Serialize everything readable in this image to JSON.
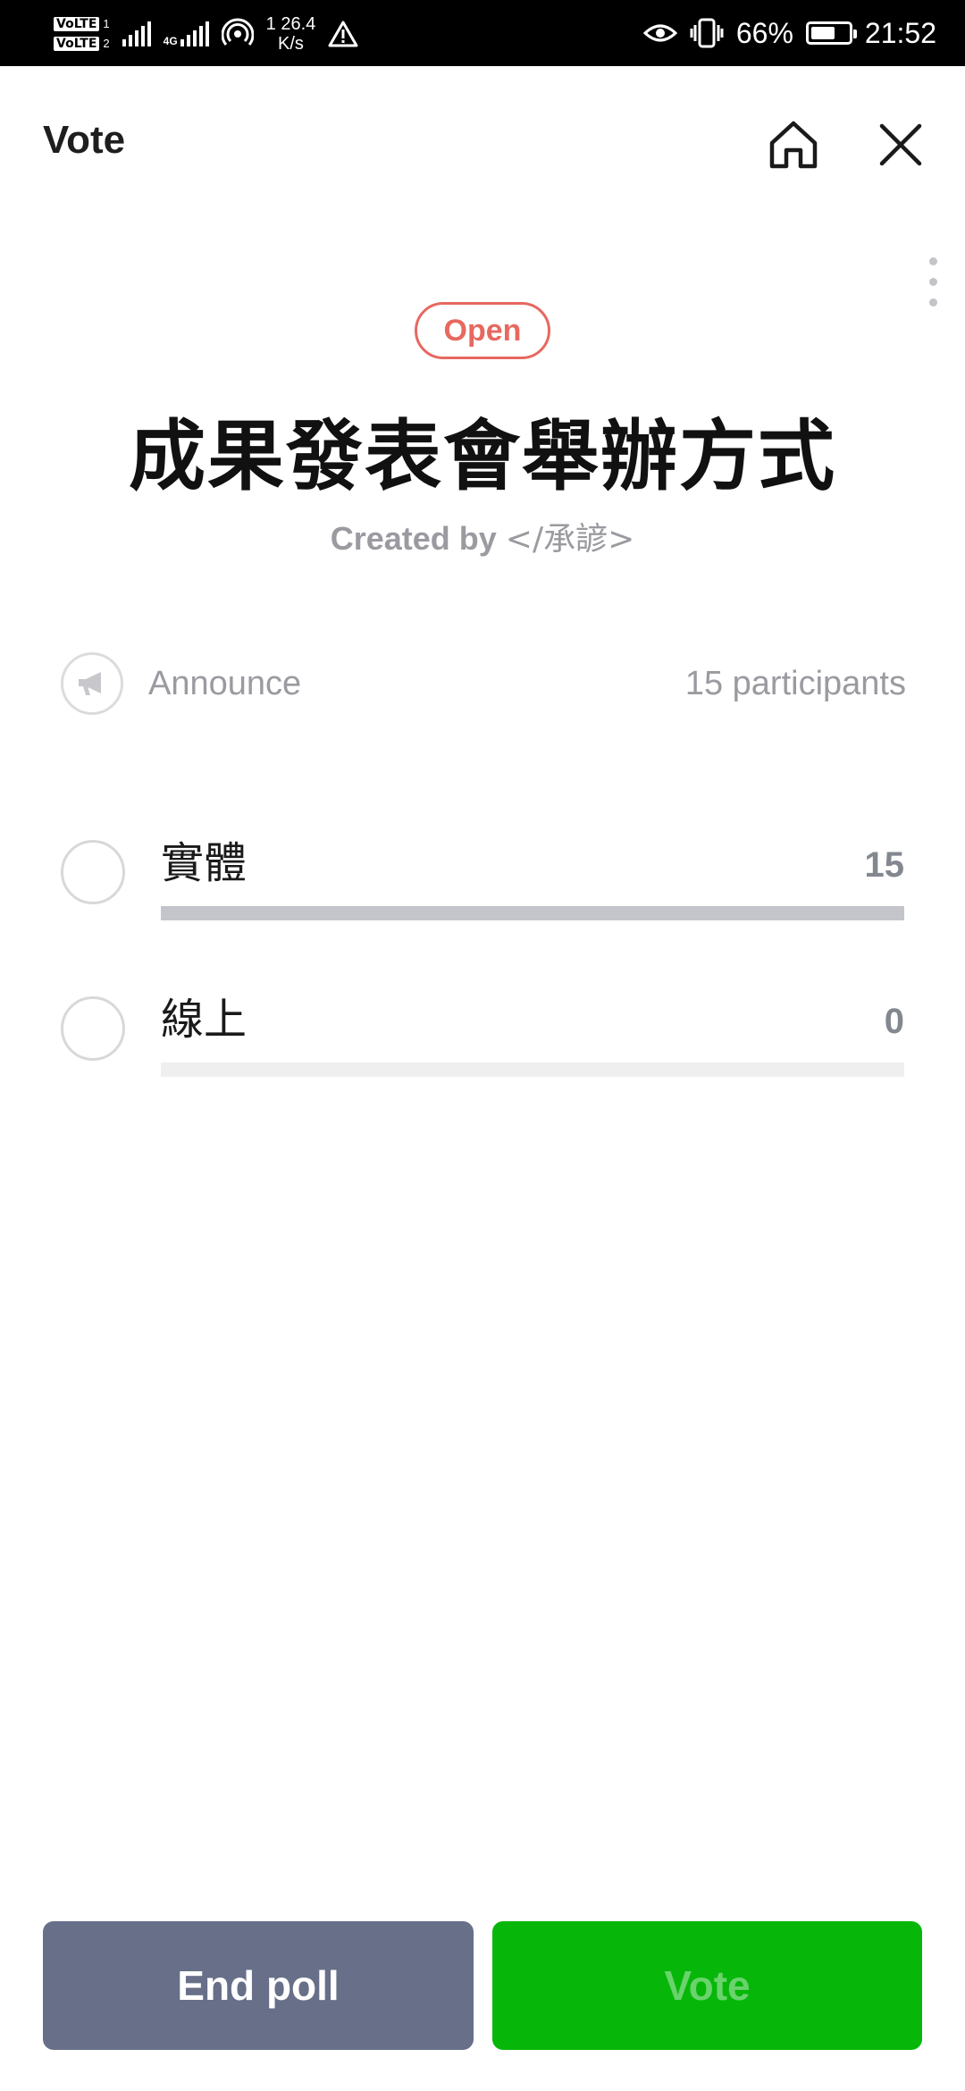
{
  "status_bar": {
    "volte1": "VoLTE",
    "volte1_num": "1",
    "volte2": "VoLTE",
    "volte2_num": "2",
    "network": "4G",
    "speed_value": "1 26.4",
    "speed_unit": "K/s",
    "battery_percent": "66%",
    "battery_level": 0.66,
    "time": "21:52"
  },
  "header": {
    "title": "Vote"
  },
  "poll": {
    "status": "Open",
    "title": "成果發表會舉辦方式",
    "created_prefix": "Created by ",
    "creator": "</承諺>",
    "announce_label": "Announce",
    "participants": "15 participants",
    "options": [
      {
        "label": "實體",
        "count": "15",
        "fraction": 1.0
      },
      {
        "label": "線上",
        "count": "0",
        "fraction": 0.0
      }
    ]
  },
  "actions": {
    "end_poll": "End poll",
    "vote": "Vote"
  },
  "colors": {
    "open_badge": "#e7685f",
    "end_button": "#676f89",
    "vote_button": "#06b70a",
    "bar_fill": "#c4c5cb"
  }
}
